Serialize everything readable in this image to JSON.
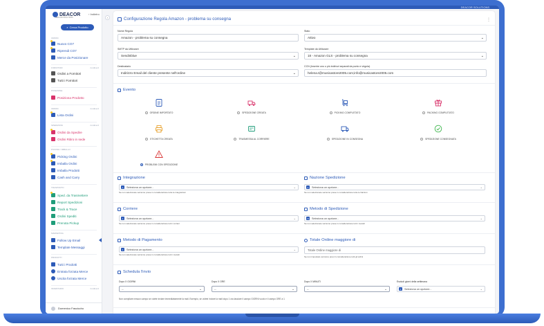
{
  "brand": {
    "name": "DEACOR",
    "tagline": "DEACOR SOLUTIONS",
    "collapse_label": "Indietro",
    "top_strip_text": "DEACOR SOLUTIONS"
  },
  "sidebar": {
    "search_label": "Cerca Prodotto",
    "sections": [
      {
        "title": "Ordini",
        "extra": ""
      },
      {
        "title": "Fornitori",
        "extra": "riordina 0"
      },
      {
        "title": "Posizione",
        "extra": ""
      },
      {
        "title": "Ordini",
        "extra": "riordina 0"
      },
      {
        "title": "Spedizioni",
        "extra": "riordina 0"
      },
      {
        "title": "Picking / Imballo",
        "extra": ""
      },
      {
        "title": "Trasporto",
        "extra": ""
      },
      {
        "title": "Marketing",
        "extra": ""
      },
      {
        "title": "Prodotti",
        "extra": ""
      },
      {
        "title": "Inventario",
        "extra": "riordina 0"
      }
    ],
    "items": [
      {
        "label": "Nuovo CO7",
        "color": "#2d5bb8"
      },
      {
        "label": "Riprendi CO7",
        "color": "#2d5bb8"
      },
      {
        "label": "Merce da Posizionare",
        "color": "#2d5bb8"
      },
      {
        "label": "Ordini a Fornitori",
        "color": "#333333"
      },
      {
        "label": "Tutti i Fornitori",
        "color": "#333333"
      },
      {
        "label": "Posiziona Prodotto",
        "color": "#d9336b"
      },
      {
        "label": "Lista Ordini",
        "color": "#2d5bb8"
      },
      {
        "label": "Ordini da Spedire",
        "color": "#d9336b"
      },
      {
        "label": "Ordini Ritiro in sede",
        "color": "#d9336b"
      },
      {
        "label": "Picking Ordini",
        "color": "#2d5bb8"
      },
      {
        "label": "Imballa Ordini",
        "color": "#2d5bb8"
      },
      {
        "label": "Imballa Prodotti",
        "color": "#2d5bb8"
      },
      {
        "label": "Cash and Carry",
        "color": "#2d5bb8"
      },
      {
        "label": "Sped. da Trasmettere",
        "color": "#1f9d7a"
      },
      {
        "label": "Report Spedizioni",
        "color": "#1f9d7a"
      },
      {
        "label": "Track & Trace",
        "color": "#1f9d7a"
      },
      {
        "label": "Ordini Spediti",
        "color": "#1f9d7a"
      },
      {
        "label": "Prenota Pickup",
        "color": "#1f9d7a"
      },
      {
        "label": "Follow Up Email",
        "color": "#2d5bb8"
      },
      {
        "label": "Template Messaggi",
        "color": "#2d5bb8"
      },
      {
        "label": "Tutti i Prodotti",
        "color": "#2d5bb8"
      },
      {
        "label": "Entrata forzata Merce",
        "color": "#2d5bb8"
      },
      {
        "label": "Uscita forzata Merce",
        "color": "#2d5bb8"
      }
    ],
    "user": "Domenico Fasciccho"
  },
  "page": {
    "title": "Configurazione Regola Amazon - problema su consegna",
    "fields": {
      "nome_regola": {
        "label": "Nome Regola",
        "value": "Amazon - problema su consegna"
      },
      "stato": {
        "label": "Stato",
        "value": "Attivo"
      },
      "smtp": {
        "label": "SMTP da Utilizzare",
        "value": "Sendinblue"
      },
      "template": {
        "label": "Template da Utilizzare",
        "value": "18 - Amazon GLS - problema su consegna"
      },
      "destinatario": {
        "label": "Destinatario",
        "value": "Indirizzo Email del cliente presente nell'ordine"
      },
      "ccn": {
        "label": "CCN (Inserire uno o più indirizzi separati da punto e virgola)",
        "value": "helena.t@musicastore2005.com;info@musicastore2005.com"
      }
    },
    "evento": {
      "title": "Evento",
      "options": [
        {
          "label": "ORDINE IMPORTATO",
          "icon": "clipboard-icon",
          "color": "#2d5bb8",
          "selected": false
        },
        {
          "label": "SPEDIZIONE CREATA",
          "icon": "truck-box-icon",
          "color": "#d9336b",
          "selected": false
        },
        {
          "label": "PICKING COMPLETATO",
          "icon": "cart-icon",
          "color": "#2d5bb8",
          "selected": false
        },
        {
          "label": "PACKING COMPLETATO",
          "icon": "gift-box-icon",
          "color": "#d9336b",
          "selected": false
        },
        {
          "label": "ETICHETTA CREATA",
          "icon": "printer-icon",
          "color": "#e8a12c",
          "selected": false
        },
        {
          "label": "TRASMESSA AL CORRIERE",
          "icon": "transmit-icon",
          "color": "#1f9d7a",
          "selected": false
        },
        {
          "label": "SPEDIZIONE IN CONSEGNA",
          "icon": "delivery-truck-icon",
          "color": "#2d5bb8",
          "selected": false
        },
        {
          "label": "SPEDIZIONE CONSEGNATA",
          "icon": "check-circle-icon",
          "color": "#3cb54a",
          "selected": false
        },
        {
          "label": "PROBLEMI CON SPEDIZIONE",
          "icon": "warning-icon",
          "color": "#d93636",
          "selected": true
        }
      ]
    },
    "filters": {
      "integrazione": {
        "title": "Integrazione",
        "placeholder": "Seleziona un opzione...",
        "count": "1",
        "hint": "Se non selezionate verranno prese in considerazione tutte le integrazioni"
      },
      "nazione": {
        "title": "Nazione Spedizione",
        "placeholder": "Seleziona un opzione...",
        "count": "0",
        "hint": "Se non selezionate verranno prese in considerazione tutte le Nazioni"
      },
      "corriere": {
        "title": "Corriere",
        "placeholder": "Seleziona un opzione...",
        "count": "1",
        "hint": "Se non selezionate verranno prese in considerazione tutti i corrieri"
      },
      "metodo_sped": {
        "title": "Metodo di Spedizione",
        "placeholder": "Seleziona un opzione...",
        "count": "74",
        "hint": "Se non selezionate verranno prese in considerazione tutti i metodi"
      },
      "metodo_pag": {
        "title": "Metodo di Pagamento",
        "placeholder": "Seleziona un opzione...",
        "count": "1",
        "hint": "Se non selezionate verranno prese in considerazione tutti i metodi"
      },
      "totale": {
        "title": "Totale Ordine maggiore di",
        "placeholder": "Totale Ordine maggiore di",
        "hint": "Se non impostato verranno presi in considerazione tutti gli ordini"
      }
    },
    "schedule": {
      "title": "Schedula l'invio",
      "giorni": {
        "label": "Dopo X GIORNI",
        "value": "--"
      },
      "ore": {
        "label": "Dopo X ORE",
        "value": "--"
      },
      "minuti": {
        "label": "Dopo X MINUTI",
        "value": "--"
      },
      "escludi": {
        "label": "Escludi giorni della settimana",
        "placeholder": "Seleziona un opzione...",
        "count": "0"
      },
      "note": "Non compilare nessun campo se volete inviare immediatamente la mail. Esempio, se volete inviare la mail dopo 1 ora lasciare il campo GIORNI vuoto e il campo ORE a 1"
    }
  }
}
